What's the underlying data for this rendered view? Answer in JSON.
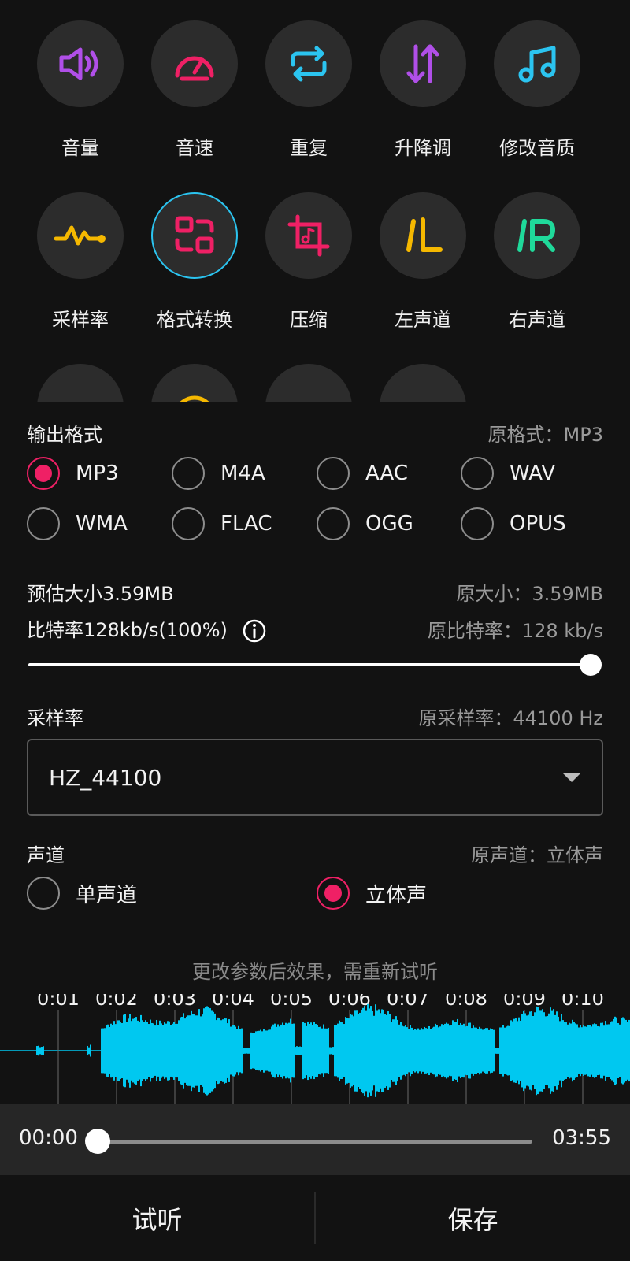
{
  "tools": [
    {
      "label": "音量",
      "icon": "speaker-volume-icon",
      "color": "#b04fe8"
    },
    {
      "label": "音速",
      "icon": "speedometer-icon",
      "color": "#ef2065"
    },
    {
      "label": "重复",
      "icon": "repeat-icon",
      "color": "#2bc4f0"
    },
    {
      "label": "升降调",
      "icon": "pitch-up-down-icon",
      "color": "#b04fe8"
    },
    {
      "label": "修改音质",
      "icon": "music-note-icon",
      "color": "#2bc4f0"
    },
    {
      "label": "采样率",
      "icon": "waveform-icon",
      "color": "#f5b800"
    },
    {
      "label": "格式转换",
      "icon": "format-convert-icon",
      "color": "#ef2065",
      "active": true
    },
    {
      "label": "压缩",
      "icon": "compress-icon",
      "color": "#ef2065"
    },
    {
      "label": "左声道",
      "icon": "left-channel-icon",
      "color": "#f5b800"
    },
    {
      "label": "右声道",
      "icon": "right-channel-icon",
      "color": "#1fd99a"
    }
  ],
  "output_format": {
    "title": "输出格式",
    "original": "原格式：MP3",
    "options": [
      "MP3",
      "M4A",
      "AAC",
      "WAV",
      "WMA",
      "FLAC",
      "OGG",
      "OPUS"
    ],
    "selected": "MP3"
  },
  "size": {
    "estimated": "预估大小3.59MB",
    "original": "原大小：3.59MB",
    "bitrate": "比特率128kb/s(100%)",
    "original_bitrate": "原比特率：128 kb/s",
    "bitrate_percent": 100
  },
  "sample_rate": {
    "title": "采样率",
    "original": "原采样率：44100 Hz",
    "value": "HZ_44100"
  },
  "channel": {
    "title": "声道",
    "original": "原声道：立体声",
    "options": [
      "单声道",
      "立体声"
    ],
    "selected": "立体声"
  },
  "note": "更改参数后效果，需重新试听",
  "timeline": [
    "0:01",
    "0:02",
    "0:03",
    "0:04",
    "0:05",
    "0:06",
    "0:07",
    "0:08",
    "0:09",
    "0:10"
  ],
  "player": {
    "current": "00:00",
    "total": "03:55",
    "progress": 0
  },
  "actions": {
    "preview": "试听",
    "save": "保存"
  },
  "colors": {
    "accent": "#ef2065",
    "waveform": "#00c8f0"
  }
}
